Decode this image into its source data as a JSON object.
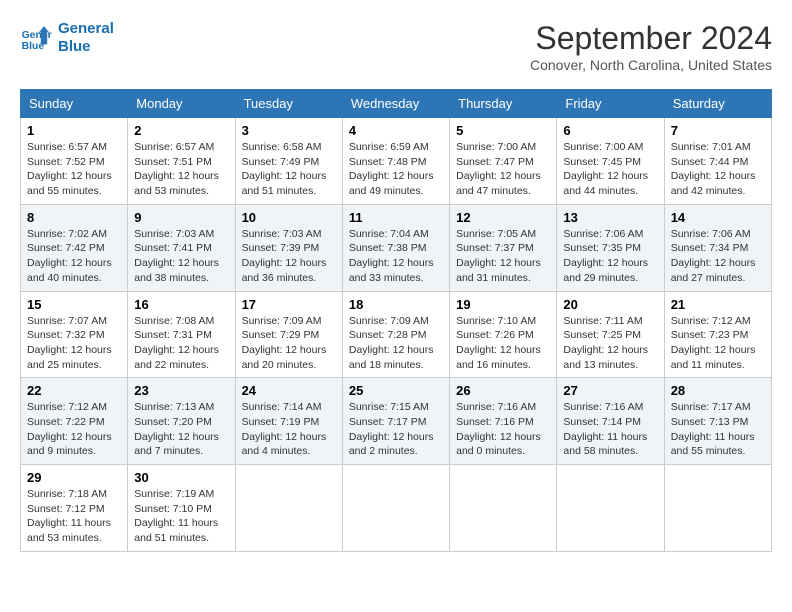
{
  "logo": {
    "line1": "General",
    "line2": "Blue"
  },
  "title": "September 2024",
  "subtitle": "Conover, North Carolina, United States",
  "weekdays": [
    "Sunday",
    "Monday",
    "Tuesday",
    "Wednesday",
    "Thursday",
    "Friday",
    "Saturday"
  ],
  "weeks": [
    [
      {
        "day": "1",
        "info": "Sunrise: 6:57 AM\nSunset: 7:52 PM\nDaylight: 12 hours\nand 55 minutes."
      },
      {
        "day": "2",
        "info": "Sunrise: 6:57 AM\nSunset: 7:51 PM\nDaylight: 12 hours\nand 53 minutes."
      },
      {
        "day": "3",
        "info": "Sunrise: 6:58 AM\nSunset: 7:49 PM\nDaylight: 12 hours\nand 51 minutes."
      },
      {
        "day": "4",
        "info": "Sunrise: 6:59 AM\nSunset: 7:48 PM\nDaylight: 12 hours\nand 49 minutes."
      },
      {
        "day": "5",
        "info": "Sunrise: 7:00 AM\nSunset: 7:47 PM\nDaylight: 12 hours\nand 47 minutes."
      },
      {
        "day": "6",
        "info": "Sunrise: 7:00 AM\nSunset: 7:45 PM\nDaylight: 12 hours\nand 44 minutes."
      },
      {
        "day": "7",
        "info": "Sunrise: 7:01 AM\nSunset: 7:44 PM\nDaylight: 12 hours\nand 42 minutes."
      }
    ],
    [
      {
        "day": "8",
        "info": "Sunrise: 7:02 AM\nSunset: 7:42 PM\nDaylight: 12 hours\nand 40 minutes."
      },
      {
        "day": "9",
        "info": "Sunrise: 7:03 AM\nSunset: 7:41 PM\nDaylight: 12 hours\nand 38 minutes."
      },
      {
        "day": "10",
        "info": "Sunrise: 7:03 AM\nSunset: 7:39 PM\nDaylight: 12 hours\nand 36 minutes."
      },
      {
        "day": "11",
        "info": "Sunrise: 7:04 AM\nSunset: 7:38 PM\nDaylight: 12 hours\nand 33 minutes."
      },
      {
        "day": "12",
        "info": "Sunrise: 7:05 AM\nSunset: 7:37 PM\nDaylight: 12 hours\nand 31 minutes."
      },
      {
        "day": "13",
        "info": "Sunrise: 7:06 AM\nSunset: 7:35 PM\nDaylight: 12 hours\nand 29 minutes."
      },
      {
        "day": "14",
        "info": "Sunrise: 7:06 AM\nSunset: 7:34 PM\nDaylight: 12 hours\nand 27 minutes."
      }
    ],
    [
      {
        "day": "15",
        "info": "Sunrise: 7:07 AM\nSunset: 7:32 PM\nDaylight: 12 hours\nand 25 minutes."
      },
      {
        "day": "16",
        "info": "Sunrise: 7:08 AM\nSunset: 7:31 PM\nDaylight: 12 hours\nand 22 minutes."
      },
      {
        "day": "17",
        "info": "Sunrise: 7:09 AM\nSunset: 7:29 PM\nDaylight: 12 hours\nand 20 minutes."
      },
      {
        "day": "18",
        "info": "Sunrise: 7:09 AM\nSunset: 7:28 PM\nDaylight: 12 hours\nand 18 minutes."
      },
      {
        "day": "19",
        "info": "Sunrise: 7:10 AM\nSunset: 7:26 PM\nDaylight: 12 hours\nand 16 minutes."
      },
      {
        "day": "20",
        "info": "Sunrise: 7:11 AM\nSunset: 7:25 PM\nDaylight: 12 hours\nand 13 minutes."
      },
      {
        "day": "21",
        "info": "Sunrise: 7:12 AM\nSunset: 7:23 PM\nDaylight: 12 hours\nand 11 minutes."
      }
    ],
    [
      {
        "day": "22",
        "info": "Sunrise: 7:12 AM\nSunset: 7:22 PM\nDaylight: 12 hours\nand 9 minutes."
      },
      {
        "day": "23",
        "info": "Sunrise: 7:13 AM\nSunset: 7:20 PM\nDaylight: 12 hours\nand 7 minutes."
      },
      {
        "day": "24",
        "info": "Sunrise: 7:14 AM\nSunset: 7:19 PM\nDaylight: 12 hours\nand 4 minutes."
      },
      {
        "day": "25",
        "info": "Sunrise: 7:15 AM\nSunset: 7:17 PM\nDaylight: 12 hours\nand 2 minutes."
      },
      {
        "day": "26",
        "info": "Sunrise: 7:16 AM\nSunset: 7:16 PM\nDaylight: 12 hours\nand 0 minutes."
      },
      {
        "day": "27",
        "info": "Sunrise: 7:16 AM\nSunset: 7:14 PM\nDaylight: 11 hours\nand 58 minutes."
      },
      {
        "day": "28",
        "info": "Sunrise: 7:17 AM\nSunset: 7:13 PM\nDaylight: 11 hours\nand 55 minutes."
      }
    ],
    [
      {
        "day": "29",
        "info": "Sunrise: 7:18 AM\nSunset: 7:12 PM\nDaylight: 11 hours\nand 53 minutes."
      },
      {
        "day": "30",
        "info": "Sunrise: 7:19 AM\nSunset: 7:10 PM\nDaylight: 11 hours\nand 51 minutes."
      },
      null,
      null,
      null,
      null,
      null
    ]
  ]
}
